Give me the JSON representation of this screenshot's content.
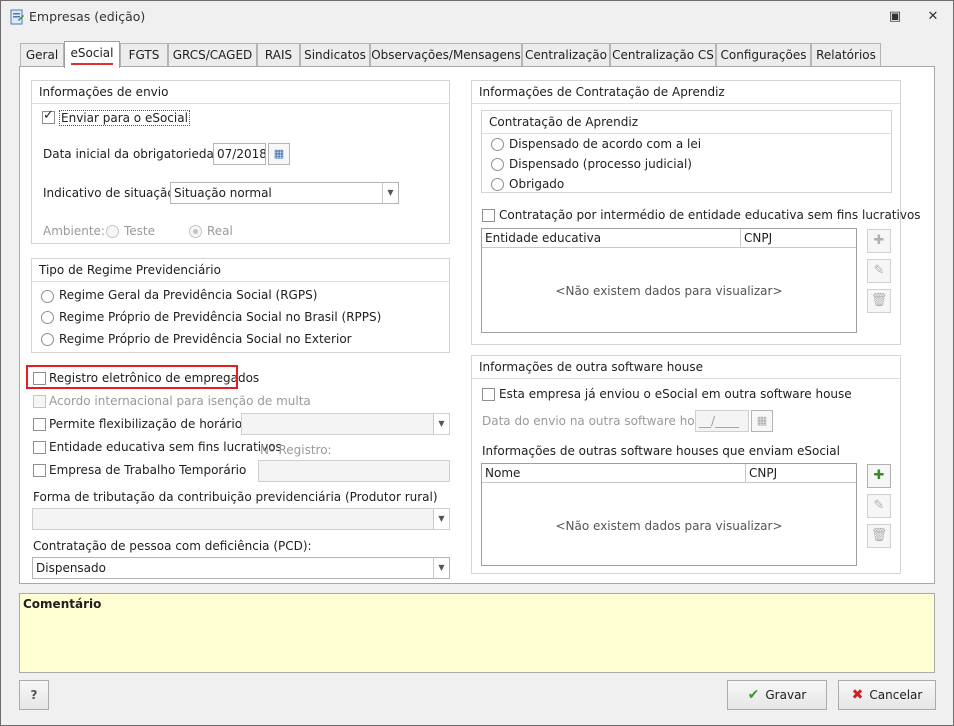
{
  "window": {
    "title": "Empresas (edição)",
    "restore_glyph": "▣",
    "close_glyph": "✕"
  },
  "tabs": [
    "Geral",
    "eSocial",
    "FGTS",
    "GRCS/CAGED",
    "RAIS",
    "Sindicatos",
    "Observações/Mensagens",
    "Centralização",
    "Centralização CS",
    "Configurações",
    "Relatórios"
  ],
  "active_tab": "eSocial",
  "envio": {
    "title": "Informações de envio",
    "enviar_label": "Enviar para o eSocial",
    "enviar_checked": true,
    "data_label": "Data inicial da obrigatoriedade:",
    "data_value": "07/2018",
    "indicativo_label": "Indicativo de situação:",
    "indicativo_value": "Situação normal",
    "ambiente_label": "Ambiente:",
    "ambiente_teste": "Teste",
    "ambiente_real": "Real"
  },
  "regime": {
    "title": "Tipo de Regime Previdenciário",
    "options": [
      "Regime Geral da Previdência Social (RGPS)",
      "Regime Próprio de Previdência Social no Brasil (RPPS)",
      "Regime Próprio de Previdência Social no Exterior"
    ]
  },
  "options": {
    "registro": "Registro eletrônico de empregados",
    "acordo": "Acordo internacional para isenção de multa",
    "flexibilizacao": "Permite flexibilização de horários",
    "entidade": "Entidade educativa sem fins lucrativos",
    "registro_num_label": "Nº Registro:",
    "temporario": "Empresa de Trabalho Temporário"
  },
  "tributacao": {
    "label": "Forma de tributação da contribuição previdenciária (Produtor rural)",
    "value": ""
  },
  "pcd": {
    "label": "Contratação de pessoa com deficiência (PCD):",
    "value": "Dispensado"
  },
  "aprendiz": {
    "title": "Informações de Contratação de Aprendiz",
    "sub_title": "Contratação de Aprendiz",
    "options": [
      "Dispensado de acordo com a lei",
      "Dispensado (processo judicial)",
      "Obrigado"
    ],
    "intermedio_label": "Contratação por intermédio de entidade educativa sem fins lucrativos",
    "grid_cols": [
      "Entidade educativa",
      "CNPJ"
    ],
    "empty": "<Não existem dados para visualizar>"
  },
  "software": {
    "title": "Informações de outra software house",
    "enviou_label": "Esta empresa já enviou o eSocial em outra software house",
    "data_label": "Data do envio na outra software house:",
    "data_value": "__/____",
    "lista_label": "Informações de outras software houses que enviam eSocial",
    "grid_cols": [
      "Nome",
      "CNPJ"
    ],
    "empty": "<Não existem dados para visualizar>"
  },
  "comment": {
    "label": "Comentário"
  },
  "footer": {
    "help": "?",
    "gravar": "Gravar",
    "cancelar": "Cancelar"
  },
  "colors": {
    "accent_red": "#e01f26",
    "comment_bg": "#fffed2"
  }
}
